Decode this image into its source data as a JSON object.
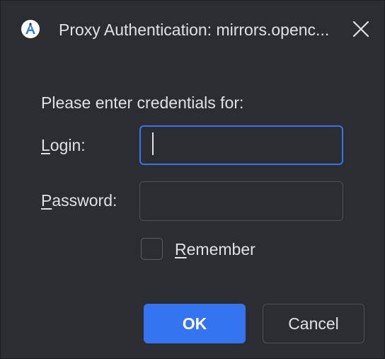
{
  "dialog": {
    "title": "Proxy Authentication: mirrors.openc...",
    "app_icon": "android-studio-icon",
    "close_icon": "close-icon"
  },
  "form": {
    "prompt": "Please enter credentials for:",
    "login_label_first": "L",
    "login_label_rest": "ogin:",
    "login_value": "",
    "password_label_first": "P",
    "password_label_rest": "assword:",
    "password_value": "",
    "remember_label_first": "R",
    "remember_label_rest": "emember",
    "remember_checked": false
  },
  "buttons": {
    "ok": "OK",
    "cancel": "Cancel"
  },
  "colors": {
    "background": "#2b2d30",
    "accent": "#3574f0",
    "text": "#dfe1e5"
  }
}
